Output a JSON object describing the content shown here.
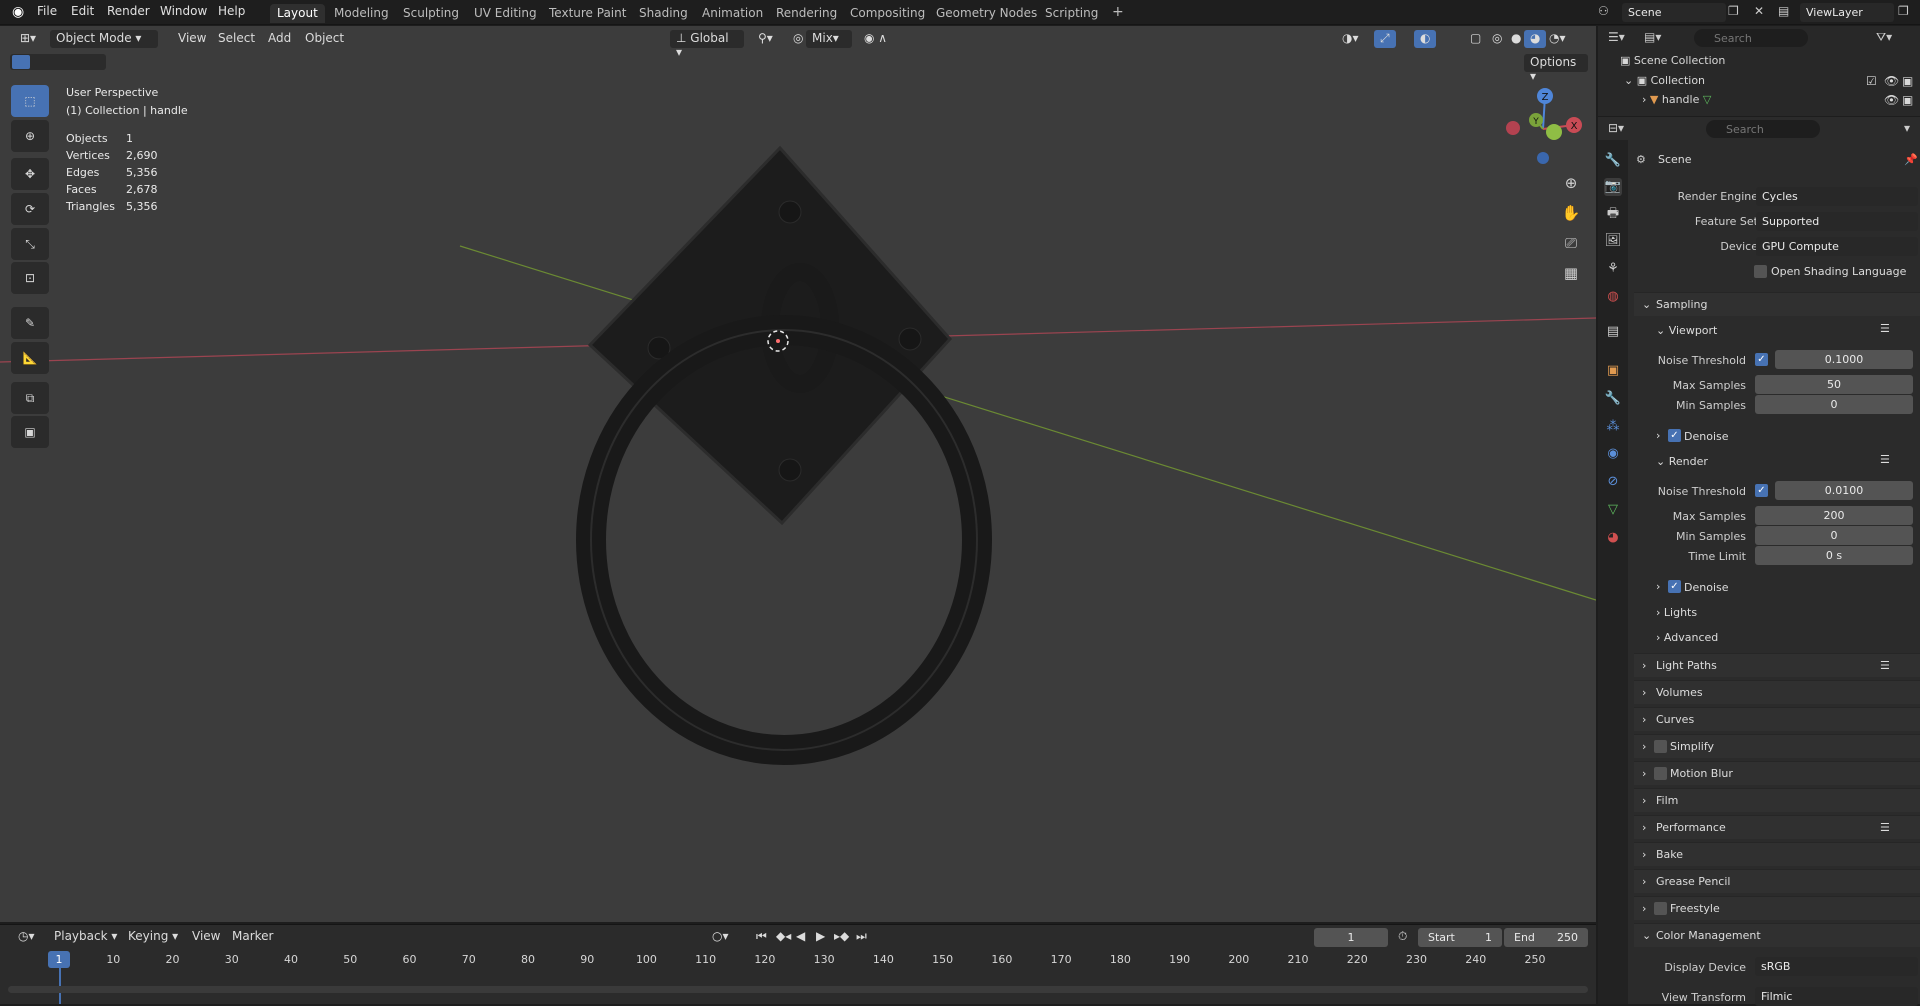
{
  "topbar": {
    "menus": [
      "File",
      "Edit",
      "Render",
      "Window",
      "Help"
    ],
    "workspaces": [
      "Layout",
      "Modeling",
      "Sculpting",
      "UV Editing",
      "Texture Paint",
      "Shading",
      "Animation",
      "Rendering",
      "Compositing",
      "Geometry Nodes",
      "Scripting"
    ],
    "active_workspace": "Layout",
    "scene": "Scene",
    "view_layer": "ViewLayer"
  },
  "viewport": {
    "mode": "Object Mode",
    "menus": [
      "View",
      "Select",
      "Add",
      "Object"
    ],
    "orientation": "Global",
    "snap_mode": "Mix",
    "options": "Options",
    "title": "User Perspective",
    "subtitle": "(1) Collection | handle",
    "stats": [
      {
        "label": "Objects",
        "value": "1"
      },
      {
        "label": "Vertices",
        "value": "2,690"
      },
      {
        "label": "Edges",
        "value": "5,356"
      },
      {
        "label": "Faces",
        "value": "2,678"
      },
      {
        "label": "Triangles",
        "value": "5,356"
      }
    ],
    "gizmo": {
      "z": "Z",
      "y": "Y",
      "x": "X"
    },
    "colors": {
      "x_axis": "#c94b55",
      "y_axis": "#7aa33a",
      "z_axis": "#4f86d9",
      "select": "#4772b3"
    }
  },
  "outliner": {
    "search_placeholder": "Search",
    "scene_collection": "Scene Collection",
    "collection": "Collection",
    "object": "handle"
  },
  "properties": {
    "search_placeholder": "Search",
    "context": "Scene",
    "render_engine_label": "Render Engine",
    "render_engine": "Cycles",
    "feature_set_label": "Feature Set",
    "feature_set": "Supported",
    "device_label": "Device",
    "device": "GPU Compute",
    "osl": "Open Shading Language",
    "sampling": "Sampling",
    "viewport": "Viewport",
    "vp_noise_label": "Noise Threshold",
    "vp_noise": "0.1000",
    "vp_max_label": "Max Samples",
    "vp_max": "50",
    "vp_min_label": "Min Samples",
    "vp_min": "0",
    "vp_denoise": "Denoise",
    "render": "Render",
    "r_noise_label": "Noise Threshold",
    "r_noise": "0.0100",
    "r_max_label": "Max Samples",
    "r_max": "200",
    "r_min_label": "Min Samples",
    "r_min": "0",
    "r_time_label": "Time Limit",
    "r_time": "0 s",
    "r_denoise": "Denoise",
    "lights": "Lights",
    "advanced": "Advanced",
    "panels": [
      "Light Paths",
      "Volumes",
      "Curves",
      "Simplify",
      "Motion Blur",
      "Film",
      "Performance",
      "Bake",
      "Grease Pencil",
      "Freestyle",
      "Color Management"
    ],
    "display_device_label": "Display Device",
    "display_device": "sRGB",
    "view_transform_label": "View Transform",
    "view_transform": "Filmic"
  },
  "timeline": {
    "menus": [
      "Playback",
      "Keying",
      "View",
      "Marker"
    ],
    "current_frame": "1",
    "start_label": "Start",
    "start": "1",
    "end_label": "End",
    "end": "250",
    "ticks": [
      "10",
      "20",
      "30",
      "40",
      "50",
      "60",
      "70",
      "80",
      "90",
      "100",
      "110",
      "120",
      "130",
      "140",
      "150",
      "160",
      "170",
      "180",
      "190",
      "200",
      "210",
      "220",
      "230",
      "240",
      "250"
    ]
  }
}
